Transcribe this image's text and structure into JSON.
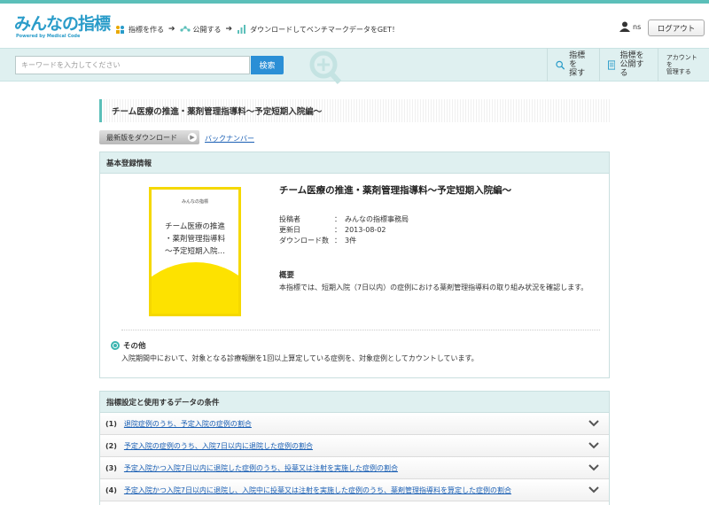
{
  "header": {
    "logo_main": "みんなの指標",
    "logo_sub": "Powered by Medical Code",
    "steps": [
      {
        "label": "指標を作る",
        "icon": "people-icon"
      },
      {
        "label": "公開する",
        "icon": "share-icon"
      },
      {
        "label": "ダウンロードしてベンチマークデータをGET！",
        "icon": "bar-chart-icon"
      }
    ],
    "username": "ns",
    "logout_label": "ログアウト"
  },
  "search": {
    "placeholder": "キーワードを入力してください",
    "button_label": "検索"
  },
  "nav": [
    {
      "label": "指標を\n探す",
      "icon": "search-icon"
    },
    {
      "label": "指標を\n公開する",
      "icon": "document-icon"
    },
    {
      "label": "アカウントを\n管理する",
      "icon": ""
    }
  ],
  "page_title": "チーム医療の推進・薬剤管理指導料～予定短期入院編～",
  "actions": {
    "download_latest": "最新版をダウンロード",
    "back_numbers": "バックナンバー"
  },
  "basic_info": {
    "heading": "基本登録情報",
    "cover_brand": "みんなの指標",
    "cover_title": "チーム医療の推進\n・薬剤管理指導料\n～予定短期入院…",
    "title": "チーム医療の推進・薬剤管理指導料～予定短期入院編～",
    "meta": [
      {
        "key": "投稿者",
        "sep": "：",
        "value": "みんなの指標事務局"
      },
      {
        "key": "更新日",
        "sep": "：",
        "value": "2013-08-02"
      },
      {
        "key": "ダウンロード数",
        "sep": "：",
        "value": "3件"
      }
    ],
    "overview_heading": "概要",
    "overview_text": "本指標では、短期入院（7日以内）の症例における薬剤管理指導料の取り組み状況を確認します。",
    "other_heading": "その他",
    "other_text": "入院期間中において、対象となる診療報酬を1回以上算定している症例を、対象症例としてカウントしています。"
  },
  "conditions": {
    "heading": "指標設定と使用するデータの条件",
    "items": [
      {
        "num": "(1)",
        "text": "退院症例のうち、予定入院の症例の割合"
      },
      {
        "num": "(2)",
        "text": "予定入院の症例のうち、入院7日以内に退院した症例の割合"
      },
      {
        "num": "(3)",
        "text": "予定入院かつ入院7日以内に退院した症例のうち、投薬又は注射を実施した症例の割合"
      },
      {
        "num": "(4)",
        "text": "予定入院かつ入院7日以内に退院し、入院中に投薬又は注射を実施した症例のうち、薬剤管理指導料を算定した症例の割合"
      }
    ]
  },
  "colors": {
    "accent_teal": "#5bbfb9",
    "search_button": "#2b8fd6",
    "cover_yellow": "#fde200",
    "link_blue": "#1a5fb4"
  }
}
